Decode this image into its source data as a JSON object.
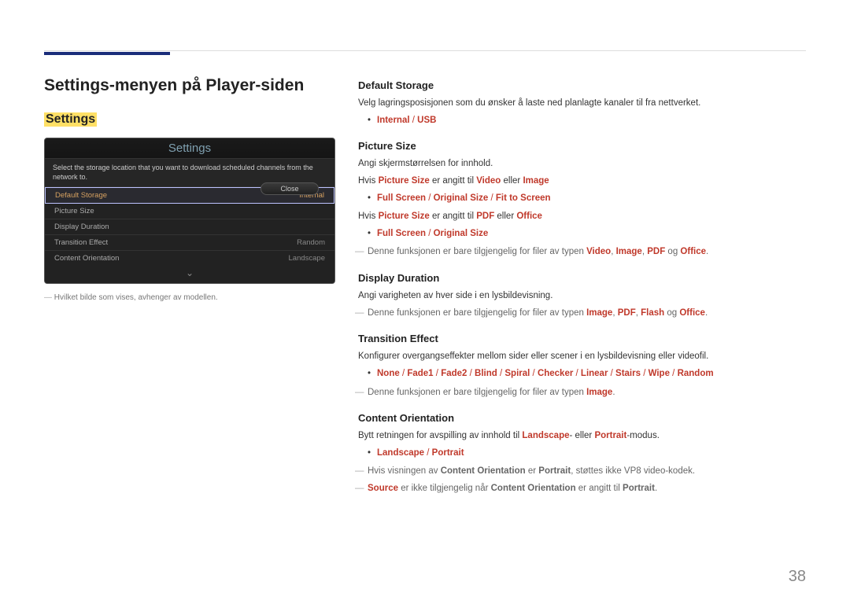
{
  "page_number": "38",
  "left": {
    "title": "Settings-menyen på Player-siden",
    "subtitle": "Settings",
    "screenshot": {
      "header": "Settings",
      "desc": "Select the storage location that you want to download scheduled channels from the network to.",
      "close": "Close",
      "rows": [
        {
          "label": "Default Storage",
          "value": "Internal",
          "selected": true
        },
        {
          "label": "Picture Size",
          "value": "",
          "selected": false
        },
        {
          "label": "Display Duration",
          "value": "",
          "selected": false
        },
        {
          "label": "Transition Effect",
          "value": "Random",
          "selected": false
        },
        {
          "label": "Content Orientation",
          "value": "Landscape",
          "selected": false
        }
      ],
      "chevron": "⌄"
    },
    "note": "Hvilket bilde som vises, avhenger av modellen."
  },
  "right": {
    "default_storage": {
      "head": "Default Storage",
      "desc": "Velg lagringsposisjonen som du ønsker å laste ned planlagte kanaler til fra nettverket.",
      "opt1": "Internal",
      "opt2": "USB"
    },
    "picture_size": {
      "head": "Picture Size",
      "p1": "Angi skjermstørrelsen for innhold.",
      "p2_a": "Hvis ",
      "p2_b": "Picture Size",
      "p2_c": " er angitt til ",
      "p2_d": "Video",
      "p2_e": " eller ",
      "p2_f": "Image",
      "b1a": "Full Screen",
      "b1b": "Original Size",
      "b1c": "Fit to Screen",
      "p3_a": "Hvis ",
      "p3_b": "Picture Size",
      "p3_c": " er angitt til ",
      "p3_d": "PDF",
      "p3_e": " eller ",
      "p3_f": "Office",
      "b2a": "Full Screen",
      "b2b": "Original Size",
      "n1_a": "Denne funksjonen er bare tilgjengelig for filer av typen ",
      "n1_v": "Video",
      "n1_i": "Image",
      "n1_p": "PDF",
      "n1_o": "Office",
      "n1_og": " og ",
      "n1_end": "."
    },
    "display_duration": {
      "head": "Display Duration",
      "p1": "Angi varigheten av hver side i en lysbildevisning.",
      "n1_a": "Denne funksjonen er bare tilgjengelig for filer av typen ",
      "n1_i": "Image",
      "n1_p": "PDF",
      "n1_f": "Flash",
      "n1_o": "Office",
      "n1_og": " og ",
      "n1_end": "."
    },
    "transition_effect": {
      "head": "Transition Effect",
      "p1": "Konfigurer overgangseffekter mellom sider eller scener i en lysbildevisning eller videofil.",
      "o1": "None",
      "o2": "Fade1",
      "o3": "Fade2",
      "o4": "Blind",
      "o5": "Spiral",
      "o6": "Checker",
      "o7": "Linear",
      "o8": "Stairs",
      "o9": "Wipe",
      "o10": "Random",
      "n1_a": "Denne funksjonen er bare tilgjengelig for filer av typen ",
      "n1_i": "Image",
      "n1_end": "."
    },
    "content_orientation": {
      "head": "Content Orientation",
      "p1_a": "Bytt retningen for avspilling av innhold til ",
      "p1_l": "Landscape",
      "p1_b": "- eller ",
      "p1_p": "Portrait",
      "p1_c": "-modus.",
      "o1": "Landscape",
      "o2": "Portrait",
      "n1_a": "Hvis visningen av ",
      "n1_b": "Content Orientation",
      "n1_c": " er ",
      "n1_d": "Portrait",
      "n1_e": ", støttes ikke VP8 video-kodek.",
      "n2_a": "Source",
      "n2_b": " er ikke tilgjengelig når ",
      "n2_c": "Content Orientation",
      "n2_d": " er angitt til ",
      "n2_e": "Portrait",
      "n2_f": "."
    }
  }
}
